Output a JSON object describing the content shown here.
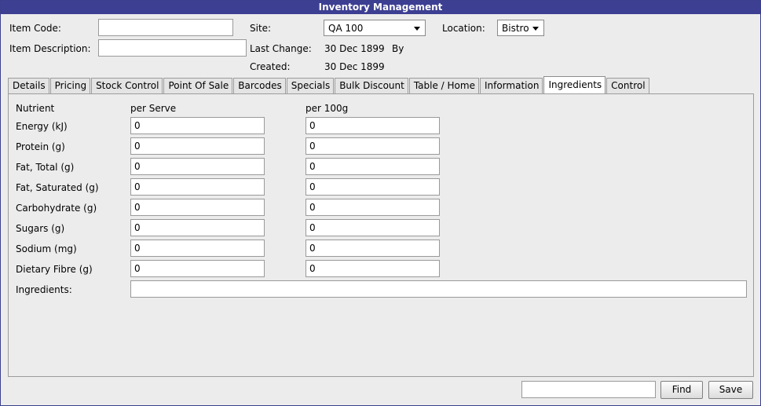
{
  "window": {
    "title": "Inventory Management"
  },
  "header": {
    "item_code_label": "Item Code:",
    "item_code_value": "",
    "item_description_label": "Item Description:",
    "item_description_value": "",
    "site_label": "Site:",
    "site_value": "QA 100",
    "location_label": "Location:",
    "location_value": "Bistro",
    "last_change_label": "Last Change:",
    "last_change_value": "30 Dec 1899",
    "by_label": "By",
    "created_label": "Created:",
    "created_value": "30 Dec 1899"
  },
  "tabs": [
    {
      "label": "Details"
    },
    {
      "label": "Pricing"
    },
    {
      "label": "Stock Control"
    },
    {
      "label": "Point Of Sale"
    },
    {
      "label": "Barcodes"
    },
    {
      "label": "Specials"
    },
    {
      "label": "Bulk Discount"
    },
    {
      "label": "Table / Home"
    },
    {
      "label": "Information"
    },
    {
      "label": "Ingredients"
    },
    {
      "label": "Control"
    }
  ],
  "active_tab": "Ingredients",
  "nutrition": {
    "col_nutrient": "Nutrient",
    "col_per_serve": "per Serve",
    "col_per_100g": "per 100g",
    "rows": [
      {
        "label": "Energy (kJ)",
        "per_serve": "0",
        "per_100g": "0"
      },
      {
        "label": "Protein (g)",
        "per_serve": "0",
        "per_100g": "0"
      },
      {
        "label": "Fat, Total (g)",
        "per_serve": "0",
        "per_100g": "0"
      },
      {
        "label": "Fat, Saturated (g)",
        "per_serve": "0",
        "per_100g": "0"
      },
      {
        "label": "Carbohydrate (g)",
        "per_serve": "0",
        "per_100g": "0"
      },
      {
        "label": "Sugars (g)",
        "per_serve": "0",
        "per_100g": "0"
      },
      {
        "label": "Sodium (mg)",
        "per_serve": "0",
        "per_100g": "0"
      },
      {
        "label": "Dietary Fibre (g)",
        "per_serve": "0",
        "per_100g": "0"
      }
    ],
    "ingredients_label": "Ingredients:",
    "ingredients_value": ""
  },
  "footer": {
    "search_value": "",
    "find_label": "Find",
    "save_label": "Save"
  }
}
